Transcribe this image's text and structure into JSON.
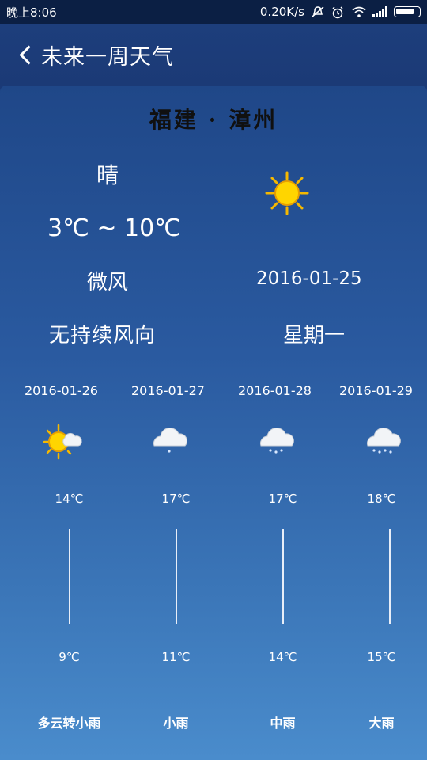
{
  "status": {
    "time": "晚上8:06",
    "speed": "0.20K/s"
  },
  "appbar": {
    "title": "未来一周天气"
  },
  "today": {
    "city": "福建 · 漳州",
    "condition": "晴",
    "temp_range": "3℃ ~ 10℃",
    "wind": "微风",
    "wind_direction": "无持续风向",
    "date": "2016-01-25",
    "weekday": "星期一",
    "icon": "sunny-icon"
  },
  "forecast": [
    {
      "date": "2016-01-26",
      "high": "14℃",
      "low": "9℃",
      "desc": "多云转小雨",
      "icon": "sun-cloud-icon"
    },
    {
      "date": "2016-01-27",
      "high": "17℃",
      "low": "11℃",
      "desc": "小雨",
      "icon": "light-rain-icon"
    },
    {
      "date": "2016-01-28",
      "high": "17℃",
      "low": "14℃",
      "desc": "中雨",
      "icon": "moderate-rain-icon"
    },
    {
      "date": "2016-01-29",
      "high": "18℃",
      "low": "15℃",
      "desc": "大雨",
      "icon": "heavy-rain-icon"
    }
  ],
  "colors": {
    "statusbar": "#0b1f44",
    "appbar": "#1b3a76",
    "card_top": "#1f4788",
    "card_bottom": "#4a8ccc"
  }
}
